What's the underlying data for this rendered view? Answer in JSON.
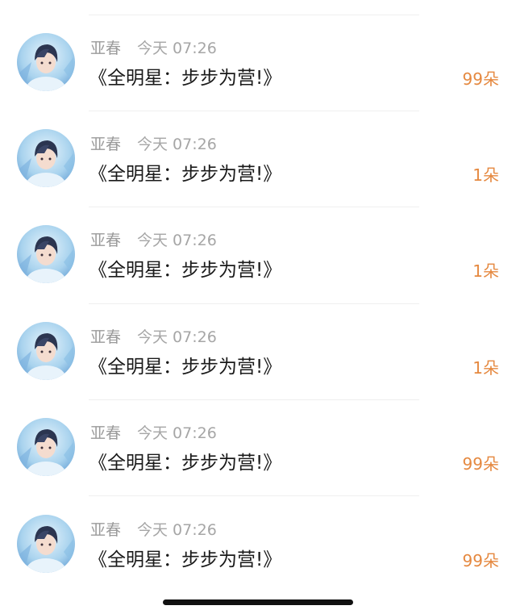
{
  "messages": [
    {
      "user": "亚春",
      "time": "今天 07:26",
      "title": "《全明星：步步为营!》",
      "count": "99朵"
    },
    {
      "user": "亚春",
      "time": "今天 07:26",
      "title": "《全明星：步步为营!》",
      "count": "1朵"
    },
    {
      "user": "亚春",
      "time": "今天 07:26",
      "title": "《全明星：步步为营!》",
      "count": "1朵"
    },
    {
      "user": "亚春",
      "time": "今天 07:26",
      "title": "《全明星：步步为营!》",
      "count": "1朵"
    },
    {
      "user": "亚春",
      "time": "今天 07:26",
      "title": "《全明星：步步为营!》",
      "count": "99朵"
    },
    {
      "user": "亚春",
      "time": "今天 07:26",
      "title": "《全明星：步步为营!》",
      "count": "99朵"
    }
  ],
  "colors": {
    "count": "#e5883f",
    "name": "#9a9a9a",
    "title": "#1a1a1a",
    "avatar_bg": "#bfe0f2"
  },
  "icons": {
    "avatar": "user-avatar-portrait"
  }
}
